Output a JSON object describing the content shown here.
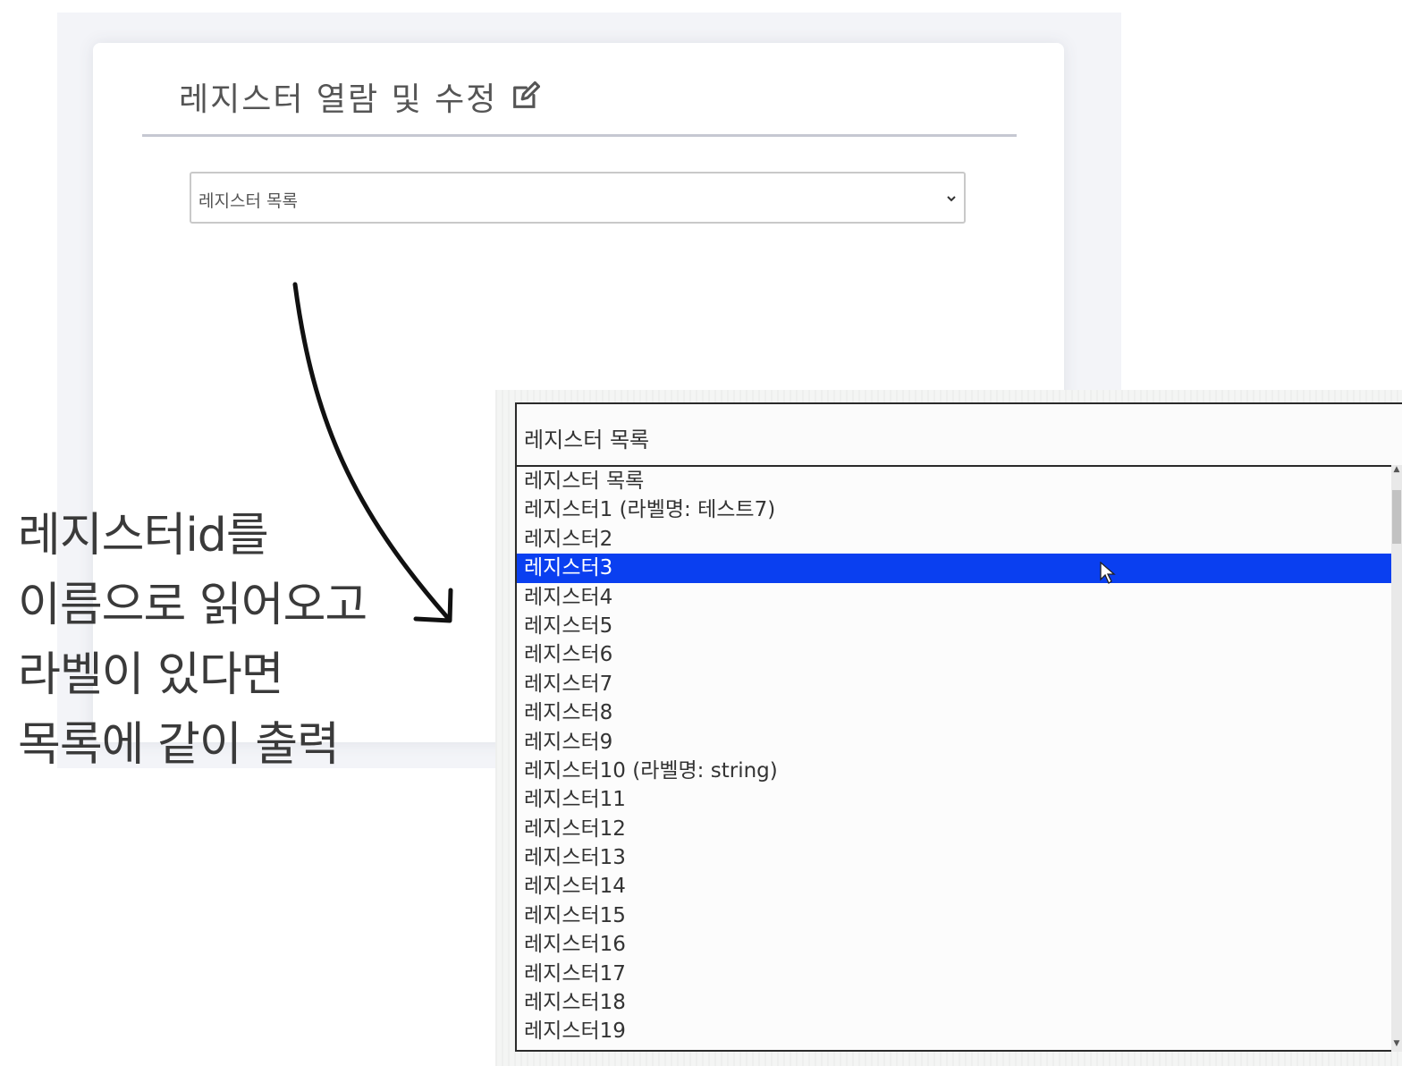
{
  "card": {
    "title": "레지스터 열람 및 수정",
    "select_value": "레지스터 목록"
  },
  "annotation": {
    "lines": [
      "레지스터id를",
      "이름으로 읽어오고",
      "라벨이 있다면",
      "목록에 같이 출력"
    ]
  },
  "dropdown": {
    "selected_value": "레지스터 목록",
    "options": [
      "레지스터 목록",
      "레지스터1 (라벨명: 테스트7)",
      "레지스터2",
      "레지스터3",
      "레지스터4",
      "레지스터5",
      "레지스터6",
      "레지스터7",
      "레지스터8",
      "레지스터9",
      "레지스터10 (라벨명: string)",
      "레지스터11",
      "레지스터12",
      "레지스터13",
      "레지스터14",
      "레지스터15",
      "레지스터16",
      "레지스터17",
      "레지스터18",
      "레지스터19"
    ],
    "highlighted_index": 3,
    "highlight_color": "#0a3ff0"
  },
  "icons": {
    "title_icon": "edit-icon",
    "select_icon": "chevron-down-icon"
  }
}
